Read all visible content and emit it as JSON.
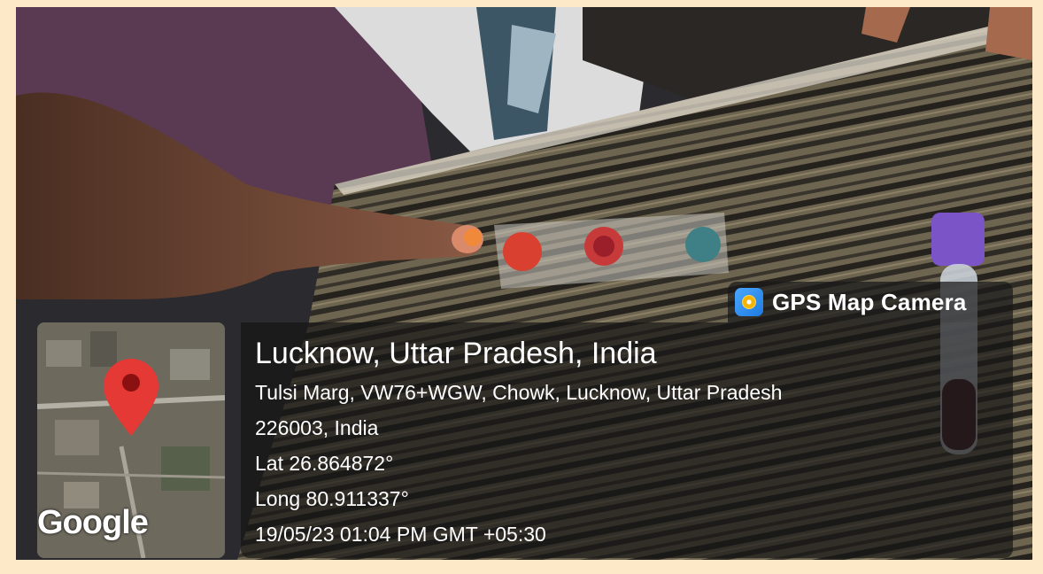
{
  "overlay": {
    "badge_label": "GPS Map Camera",
    "badge_icon": "gps-map-camera-icon",
    "location_title": "Lucknow, Uttar Pradesh, India",
    "address_line1": "Tulsi Marg, VW76+WGW, Chowk, Lucknow, Uttar Pradesh",
    "address_line2": "226003, India",
    "latitude": "Lat 26.864872°",
    "longitude": "Long 80.911337°",
    "datetime": "19/05/23 01:04 PM GMT +05:30"
  },
  "map_thumbnail": {
    "attribution": "Google",
    "marker_icon": "map-pin-icon",
    "marker_color": "#e53935"
  },
  "colors": {
    "overlay_bg": "#141414",
    "frame_border": "#fde9c7"
  }
}
